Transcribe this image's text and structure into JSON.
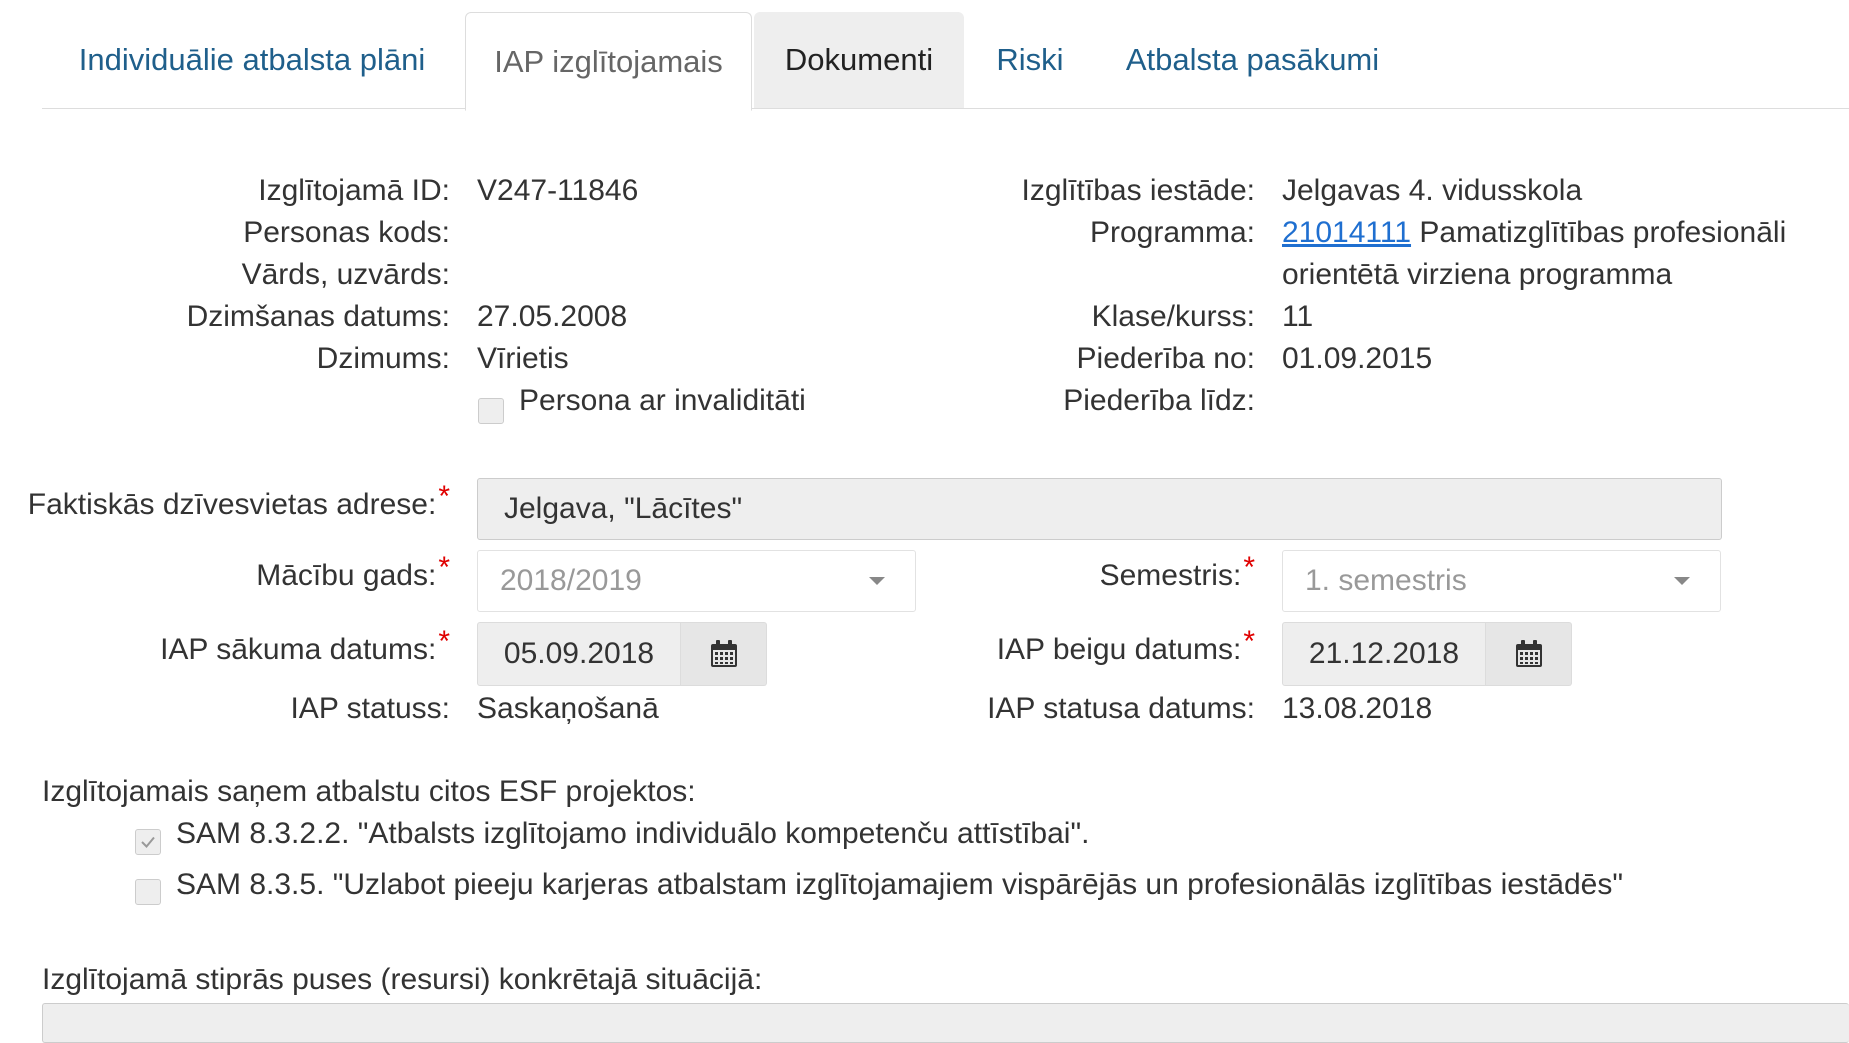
{
  "tabs": [
    {
      "label": "Individuālie atbalsta plāni"
    },
    {
      "label": "IAP izglītojamais"
    },
    {
      "label": "Dokumenti"
    },
    {
      "label": "Riski"
    },
    {
      "label": "Atbalsta pasākumi"
    }
  ],
  "student_info": {
    "id_label": "Izglītojamā ID:",
    "id_value": "V247-11846",
    "personal_code_label": "Personas kods:",
    "personal_code_value": "",
    "name_label": "Vārds, uzvārds:",
    "name_value": "",
    "birth_date_label": "Dzimšanas datums:",
    "birth_date_value": "27.05.2008",
    "gender_label": "Dzimums:",
    "gender_value": "Vīrietis",
    "disability_label": "Persona ar invaliditāti"
  },
  "school_info": {
    "school_label": "Izglītības iestāde:",
    "school_value": "Jelgavas 4. vidusskola",
    "program_label": "Programma:",
    "program_code": "21014111",
    "program_name_line1": "Pamatizglītības profesionāli",
    "program_name_line2": "orientētā virziena programma",
    "class_label": "Klase/kurss:",
    "class_value": "11",
    "member_from_label": "Piederība no:",
    "member_from_value": "01.09.2015",
    "member_to_label": "Piederība līdz:",
    "member_to_value": ""
  },
  "form": {
    "address_label": "Faktiskās dzīvesvietas adrese:",
    "address_value": "Jelgava, \"Lācītes\"",
    "study_year_label": "Mācību gads:",
    "study_year_value": "2018/2019",
    "semester_label": "Semestris:",
    "semester_value": "1. semestris",
    "start_date_label": "IAP sākuma datums:",
    "start_date_value": "05.09.2018",
    "end_date_label": "IAP beigu datums:",
    "end_date_value": "21.12.2018",
    "status_label": "IAP statuss:",
    "status_value": "Saskaņošanā",
    "status_date_label": "IAP statusa datums:",
    "status_date_value": "13.08.2018",
    "required_marker": "*"
  },
  "esf": {
    "heading": "Izglītojamais saņem atbalstu citos ESF projektos:",
    "options": [
      {
        "label": "SAM 8.3.2.2. \"Atbalsts izglītojamo individuālo kompetenču attīstībai\".",
        "checked": true
      },
      {
        "label": "SAM 8.3.5. \"Uzlabot pieeju karjeras atbalstam izglītojamajiem vispārējās un profesionālās izglītības iestādēs\"",
        "checked": false
      }
    ]
  },
  "strengths": {
    "heading": "Izglītojamā stiprās puses (resursi) konkrētajā situācijā:",
    "value": ""
  },
  "colors": {
    "link": "#1f6fd0",
    "tab_link": "#1f5f8b",
    "required": "#e00000",
    "field_bg": "#eeeeee"
  }
}
